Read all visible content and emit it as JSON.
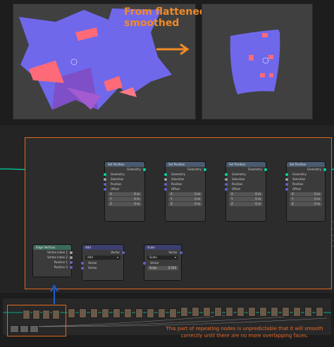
{
  "headline": "From flattened to smoothed",
  "caption": "This part of repeating nodes is unpredictable that it will smooth correctly until there are no more overlapping faces.",
  "colors": {
    "accent": "#e06a20",
    "geometry_socket": "#00d6a3",
    "vector_socket": "#6363c7",
    "mesh_face": "#7a72f0",
    "overlap_face": "#ff6a78"
  },
  "set_position_nodes": [
    {
      "title": "Set Position",
      "output": "Geometry",
      "inputs": [
        "Geometry",
        "Selection",
        "Position",
        "Offset"
      ],
      "fields": [
        {
          "label": "X",
          "value": "0 m"
        },
        {
          "label": "Y",
          "value": "0 m"
        },
        {
          "label": "Z",
          "value": "0 m"
        }
      ]
    },
    {
      "title": "Set Position",
      "output": "Geometry",
      "inputs": [
        "Geometry",
        "Selection",
        "Position",
        "Offset"
      ],
      "fields": [
        {
          "label": "X",
          "value": "0 m"
        },
        {
          "label": "Y",
          "value": "0 m"
        },
        {
          "label": "Z",
          "value": "0 m"
        }
      ]
    },
    {
      "title": "Set Position",
      "output": "Geometry",
      "inputs": [
        "Geometry",
        "Selection",
        "Position",
        "Offset"
      ],
      "fields": [
        {
          "label": "X",
          "value": "0 m"
        },
        {
          "label": "Y",
          "value": "0 m"
        },
        {
          "label": "Z",
          "value": "0 m"
        }
      ]
    },
    {
      "title": "Set Position",
      "output": "Geometry",
      "inputs": [
        "Geometry",
        "Selection",
        "Position",
        "Offset"
      ],
      "fields": [
        {
          "label": "X",
          "value": "0 m"
        },
        {
          "label": "Y",
          "value": "0 m"
        },
        {
          "label": "Z",
          "value": "0 m"
        }
      ]
    }
  ],
  "edge_vertices": {
    "title": "Edge Vertices",
    "outputs": [
      "Vertex Index 1",
      "Vertex Index 2",
      "Position 1",
      "Position 2"
    ]
  },
  "add_node": {
    "title": "Add",
    "output": "Vector",
    "operation": "Add",
    "inputs": [
      "Vector",
      "Vector"
    ]
  },
  "scale_node": {
    "title": "Scale",
    "output": "Vector",
    "operation": "Scale",
    "input": "Vector",
    "scale_label": "Scale",
    "scale_value": "0.500"
  }
}
